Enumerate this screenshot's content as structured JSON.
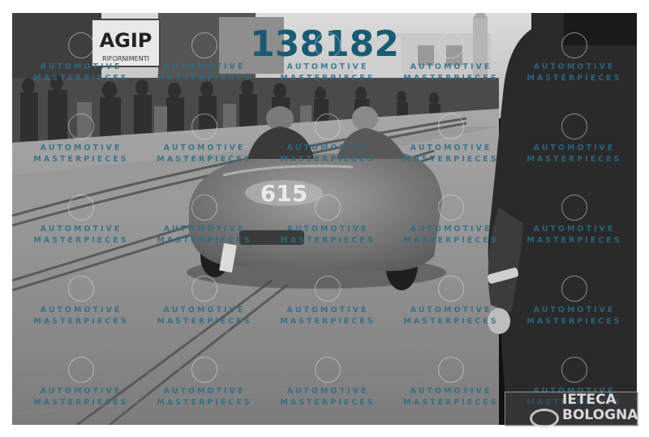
{
  "photo": {
    "description_icon": "vintage-racing-car-photo",
    "banner_main": "AGIP",
    "banner_sub": "RIFORNIMENTI",
    "race_number": "615"
  },
  "id_number": "138182",
  "watermark": {
    "line1": "AUTOMOTIVE",
    "line2": "MASTERPIECES"
  },
  "archive_logo": {
    "line1": "IETECA",
    "line2": "BOLOGNA"
  },
  "colors": {
    "id_number": "#1a5a73",
    "watermark": "#2c6c88"
  }
}
